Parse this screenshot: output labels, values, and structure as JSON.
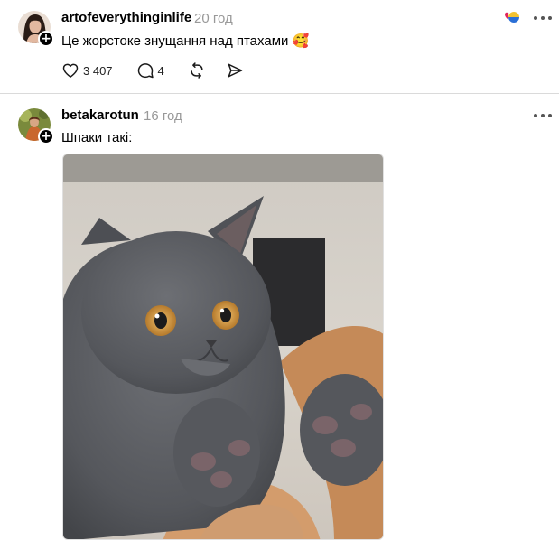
{
  "posts": [
    {
      "username": "artofeverythinginlife",
      "time": "20 год",
      "text": "Це жорстоке знущання над птахами",
      "emoji": "🥰",
      "actions": {
        "likes": "3 407",
        "comments": "4"
      },
      "icons": {
        "avatar": "avatar-woman-dark-hair",
        "follow": "plus-icon",
        "reactions": "heart-pride-reaction-icon",
        "more": "more-dots-icon",
        "like": "heart-icon",
        "comment": "comment-icon",
        "repost": "repost-icon",
        "share": "share-send-icon"
      }
    },
    {
      "username": "betakarotun",
      "time": "16 год",
      "text": "Шпаки такі:",
      "image": "grey-british-shorthair-kitten-surprised",
      "icons": {
        "avatar": "avatar-woman-outdoors",
        "follow": "plus-icon",
        "more": "more-dots-icon"
      }
    }
  ],
  "colors": {
    "time": "#999999",
    "divider": "#dadada",
    "icon": "#1a1a1a"
  }
}
